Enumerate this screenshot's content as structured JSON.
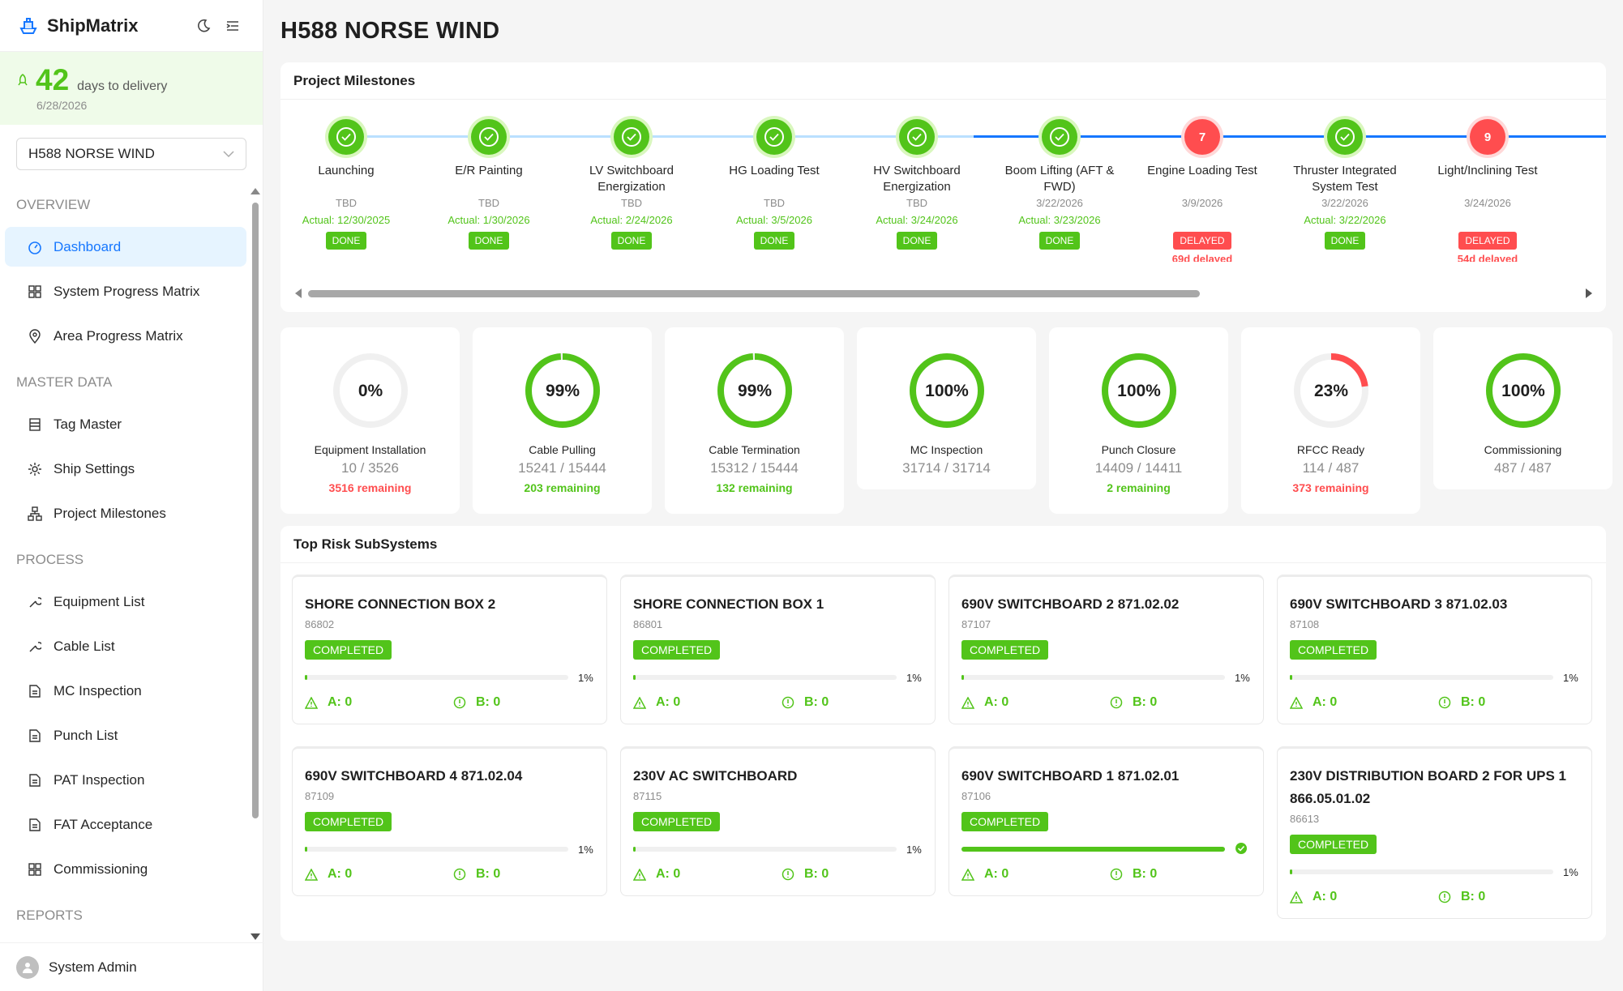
{
  "app": {
    "name": "ShipMatrix"
  },
  "delivery": {
    "days": "42",
    "label": "days to delivery",
    "date": "6/28/2026"
  },
  "ship_select": {
    "value": "H588 NORSE WIND"
  },
  "sidebar": {
    "sections": {
      "overview": "OVERVIEW",
      "master_data": "MASTER DATA",
      "process": "PROCESS",
      "reports": "REPORTS"
    },
    "items": {
      "dashboard": "Dashboard",
      "system_progress_matrix": "System Progress Matrix",
      "area_progress_matrix": "Area Progress Matrix",
      "tag_master": "Tag Master",
      "ship_settings": "Ship Settings",
      "project_milestones": "Project Milestones",
      "equipment_list": "Equipment List",
      "cable_list": "Cable List",
      "mc_inspection": "MC Inspection",
      "punch_list": "Punch List",
      "pat_inspection": "PAT Inspection",
      "fat_acceptance": "FAT Acceptance",
      "commissioning": "Commissioning"
    },
    "user": "System Admin"
  },
  "page": {
    "title": "H588 NORSE WIND"
  },
  "milestones": {
    "title": "Project Milestones",
    "items": [
      {
        "name": "Launching",
        "plan": "TBD",
        "actual": "Actual: 12/30/2025",
        "status": "DONE",
        "delay": "",
        "done": true,
        "num": ""
      },
      {
        "name": "E/R Painting",
        "plan": "TBD",
        "actual": "Actual: 1/30/2026",
        "status": "DONE",
        "delay": "",
        "done": true,
        "num": ""
      },
      {
        "name": "LV Switchboard Energization",
        "plan": "TBD",
        "actual": "Actual: 2/24/2026",
        "status": "DONE",
        "delay": "",
        "done": true,
        "num": ""
      },
      {
        "name": "HG Loading Test",
        "plan": "TBD",
        "actual": "Actual: 3/5/2026",
        "status": "DONE",
        "delay": "",
        "done": true,
        "num": ""
      },
      {
        "name": "HV Switchboard Energization",
        "plan": "TBD",
        "actual": "Actual: 3/24/2026",
        "status": "DONE",
        "delay": "",
        "done": true,
        "num": ""
      },
      {
        "name": "Boom Lifting (AFT & FWD)",
        "plan": "3/22/2026",
        "actual": "Actual: 3/23/2026",
        "status": "DONE",
        "delay": "",
        "done": true,
        "num": ""
      },
      {
        "name": "Engine Loading Test",
        "plan": "3/9/2026",
        "actual": "",
        "status": "DELAYED",
        "delay": "69d delayed",
        "done": false,
        "num": "7"
      },
      {
        "name": "Thruster Integrated System Test",
        "plan": "3/22/2026",
        "actual": "Actual: 3/22/2026",
        "status": "DONE",
        "delay": "",
        "done": true,
        "num": ""
      },
      {
        "name": "Light/Inclining Test",
        "plan": "3/24/2026",
        "actual": "",
        "status": "DELAYED",
        "delay": "54d delayed",
        "done": false,
        "num": "9"
      }
    ]
  },
  "stats": [
    {
      "pct_text": "0%",
      "pct": 0,
      "label": "Equipment Installation",
      "count": "10 / 3526",
      "remaining": "3516 remaining",
      "rem_color": "red",
      "ring": "#f0f0f0"
    },
    {
      "pct_text": "99%",
      "pct": 99,
      "label": "Cable Pulling",
      "count": "15241 / 15444",
      "remaining": "203 remaining",
      "rem_color": "green",
      "ring": "#52c41a"
    },
    {
      "pct_text": "99%",
      "pct": 99,
      "label": "Cable Termination",
      "count": "15312 / 15444",
      "remaining": "132 remaining",
      "rem_color": "green",
      "ring": "#52c41a"
    },
    {
      "pct_text": "100%",
      "pct": 100,
      "label": "MC Inspection",
      "count": "31714 / 31714",
      "remaining": "",
      "rem_color": "green",
      "ring": "#52c41a"
    },
    {
      "pct_text": "100%",
      "pct": 100,
      "label": "Punch Closure",
      "count": "14409 / 14411",
      "remaining": "2 remaining",
      "rem_color": "green",
      "ring": "#52c41a"
    },
    {
      "pct_text": "23%",
      "pct": 23,
      "label": "RFCC Ready",
      "count": "114 / 487",
      "remaining": "373 remaining",
      "rem_color": "red",
      "ring": "#ff4d4f"
    },
    {
      "pct_text": "100%",
      "pct": 100,
      "label": "Commissioning",
      "count": "487 / 487",
      "remaining": "",
      "rem_color": "green",
      "ring": "#52c41a"
    }
  ],
  "risk": {
    "title": "Top Risk SubSystems",
    "items": [
      {
        "title": "SHORE CONNECTION BOX 2",
        "code": "86802",
        "status": "COMPLETED",
        "progress": 1,
        "pct": "1%",
        "a": "A: 0",
        "b": "B: 0"
      },
      {
        "title": "SHORE CONNECTION BOX 1",
        "code": "86801",
        "status": "COMPLETED",
        "progress": 1,
        "pct": "1%",
        "a": "A: 0",
        "b": "B: 0"
      },
      {
        "title": "690V SWITCHBOARD 2 871.02.02",
        "code": "87107",
        "status": "COMPLETED",
        "progress": 1,
        "pct": "1%",
        "a": "A: 0",
        "b": "B: 0"
      },
      {
        "title": "690V SWITCHBOARD 3 871.02.03",
        "code": "87108",
        "status": "COMPLETED",
        "progress": 1,
        "pct": "1%",
        "a": "A: 0",
        "b": "B: 0"
      },
      {
        "title": "690V SWITCHBOARD 4 871.02.04",
        "code": "87109",
        "status": "COMPLETED",
        "progress": 1,
        "pct": "1%",
        "a": "A: 0",
        "b": "B: 0"
      },
      {
        "title": "230V AC SWITCHBOARD",
        "code": "87115",
        "status": "COMPLETED",
        "progress": 1,
        "pct": "1%",
        "a": "A: 0",
        "b": "B: 0"
      },
      {
        "title": "690V SWITCHBOARD 1 871.02.01",
        "code": "87106",
        "status": "COMPLETED",
        "progress": 100,
        "pct": "",
        "a": "A: 0",
        "b": "B: 0"
      },
      {
        "title": "230V DISTRIBUTION BOARD 2 FOR UPS 1 866.05.01.02",
        "code": "86613",
        "status": "COMPLETED",
        "progress": 1,
        "pct": "1%",
        "a": "A: 0",
        "b": "B: 0"
      }
    ]
  },
  "colors": {
    "accent": "#1677ff",
    "success": "#52c41a",
    "danger": "#ff4d4f"
  }
}
